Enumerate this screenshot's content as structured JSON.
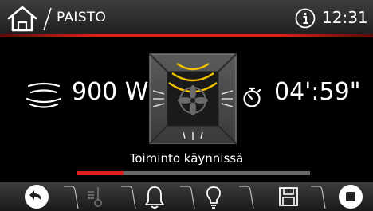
{
  "header": {
    "title": "PAISTO",
    "time": "12:31"
  },
  "icons": {
    "home": "home-icon",
    "info": "info-icon",
    "power": "heat-waves-icon",
    "timer": "stopwatch-icon",
    "oven": "oven-fan-heating-icon"
  },
  "main": {
    "power": "900 W",
    "timer": "04':59\"",
    "status": "Toiminto käynnissä",
    "progress_fraction": 0.2
  },
  "bottom_bar": {
    "buttons": [
      "back-icon",
      "thermometer-icon",
      "bell-icon",
      "lightbulb-icon",
      "save-icon",
      "stop-icon"
    ],
    "disabled": [
      "thermometer-icon"
    ]
  },
  "colors": {
    "accent": "#e0201e",
    "fan_arcs": "#f2c200",
    "bar_bg": "#2e2e2e"
  }
}
